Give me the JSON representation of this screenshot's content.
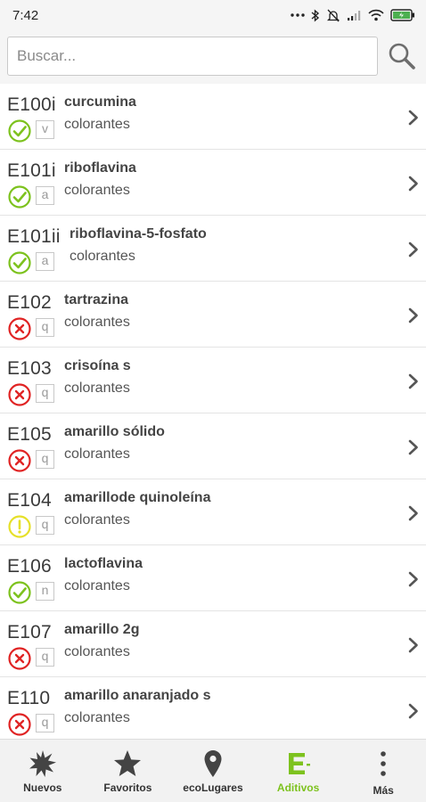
{
  "status_bar": {
    "time": "7:42"
  },
  "search": {
    "placeholder": "Buscar..."
  },
  "colors": {
    "ok": "#7dc21e",
    "bad": "#e02424",
    "warn": "#e6e02a",
    "accent": "#7dc21e"
  },
  "additives": [
    {
      "code": "E100i",
      "name": "curcumina",
      "category": "colorantes",
      "status": "ok",
      "letter": "v"
    },
    {
      "code": "E101i",
      "name": "riboflavina",
      "category": "colorantes",
      "status": "ok",
      "letter": "a"
    },
    {
      "code": "E101ii",
      "name": "riboflavina-5-fosfato",
      "category": "colorantes",
      "status": "ok",
      "letter": "a"
    },
    {
      "code": "E102",
      "name": "tartrazina",
      "category": "colorantes",
      "status": "bad",
      "letter": "q"
    },
    {
      "code": "E103",
      "name": "crisoína s",
      "category": "colorantes",
      "status": "bad",
      "letter": "q"
    },
    {
      "code": "E105",
      "name": "amarillo sólido",
      "category": "colorantes",
      "status": "bad",
      "letter": "q"
    },
    {
      "code": "E104",
      "name": "amarillode quinoleína",
      "category": "colorantes",
      "status": "warn",
      "letter": "q"
    },
    {
      "code": "E106",
      "name": "lactoflavina",
      "category": "colorantes",
      "status": "ok",
      "letter": "n"
    },
    {
      "code": "E107",
      "name": "amarillo 2g",
      "category": "colorantes",
      "status": "bad",
      "letter": "q"
    },
    {
      "code": "E110",
      "name": "amarillo anaranjado s",
      "category": "colorantes",
      "status": "bad",
      "letter": "q"
    }
  ],
  "nav": [
    {
      "key": "nuevos",
      "label": "Nuevos",
      "icon": "burst-icon",
      "active": false
    },
    {
      "key": "favoritos",
      "label": "Favoritos",
      "icon": "star-icon",
      "active": false
    },
    {
      "key": "ecolugares",
      "label": "ecoLugares",
      "icon": "location-pin-icon",
      "active": false
    },
    {
      "key": "aditivos",
      "label": "Aditivos",
      "icon": "e-additives-icon",
      "active": true
    },
    {
      "key": "mas",
      "label": "Más",
      "icon": "more-vertical-icon",
      "active": false
    }
  ]
}
